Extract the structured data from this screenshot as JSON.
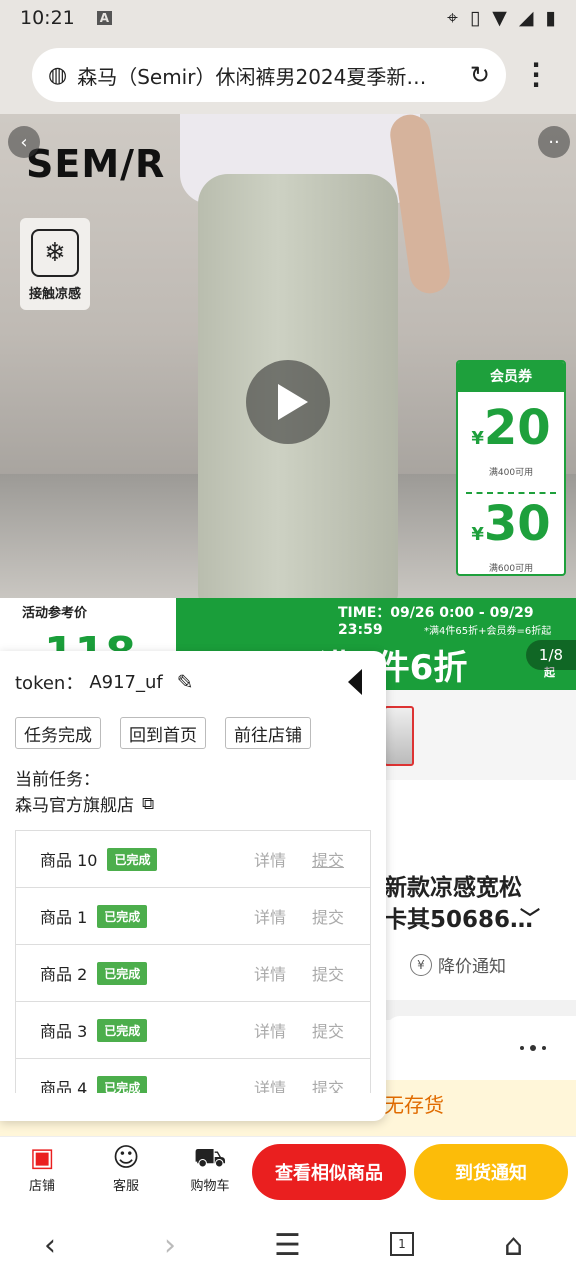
{
  "status_bar": {
    "time": "10:21",
    "sim_letter": "A"
  },
  "browser": {
    "url_title": "森马（Semir）休闲裤男2024夏季新款凉感宽松"
  },
  "hero": {
    "brand_logo": "SEM/R",
    "cool_badge_label": "接触凉感",
    "coupon": {
      "header": "会员券",
      "items": [
        {
          "currency": "¥",
          "amount": "20",
          "condition": "满400可用"
        },
        {
          "currency": "¥",
          "amount": "30",
          "condition": "满600可用"
        }
      ]
    }
  },
  "promo": {
    "ref_label": "活动参考价",
    "ref_price": "118",
    "time": "TIME：09/26 0:00 - 09/29 23:59",
    "rule": "*满4件65折+会员券=6折起",
    "headline": "满4件6折",
    "qi": "起",
    "pager": "1/8"
  },
  "product": {
    "title_line1": "新款凉感宽松",
    "title_line2": "卡其50686…",
    "price_alert": "降价通知"
  },
  "stock": {
    "text": "无存货"
  },
  "bottom_bar": {
    "store": "店铺",
    "service": "客服",
    "cart": "购物车",
    "similar_button": "查看相似商品",
    "notify_button": "到货通知"
  },
  "overlay": {
    "token_label": "token：",
    "token_value": "A917_uf",
    "buttons": [
      "任务完成",
      "回到首页",
      "前往店铺"
    ],
    "current_task_label": "当前任务：",
    "current_store": "森马官方旗舰店",
    "detail_label": "详情",
    "submit_label": "提交",
    "tasks": [
      {
        "name": "商品 10",
        "status": "已完成"
      },
      {
        "name": "商品 1",
        "status": "已完成"
      },
      {
        "name": "商品 2",
        "status": "已完成"
      },
      {
        "name": "商品 3",
        "status": "已完成"
      },
      {
        "name": "商品 4",
        "status": "已完成"
      }
    ]
  },
  "nav": {
    "tab_count": "1"
  },
  "colors": {
    "green": "#1a9e3a",
    "red": "#ea1f1f",
    "yellow": "#fcbc09",
    "badge_green": "#4cae4c"
  }
}
